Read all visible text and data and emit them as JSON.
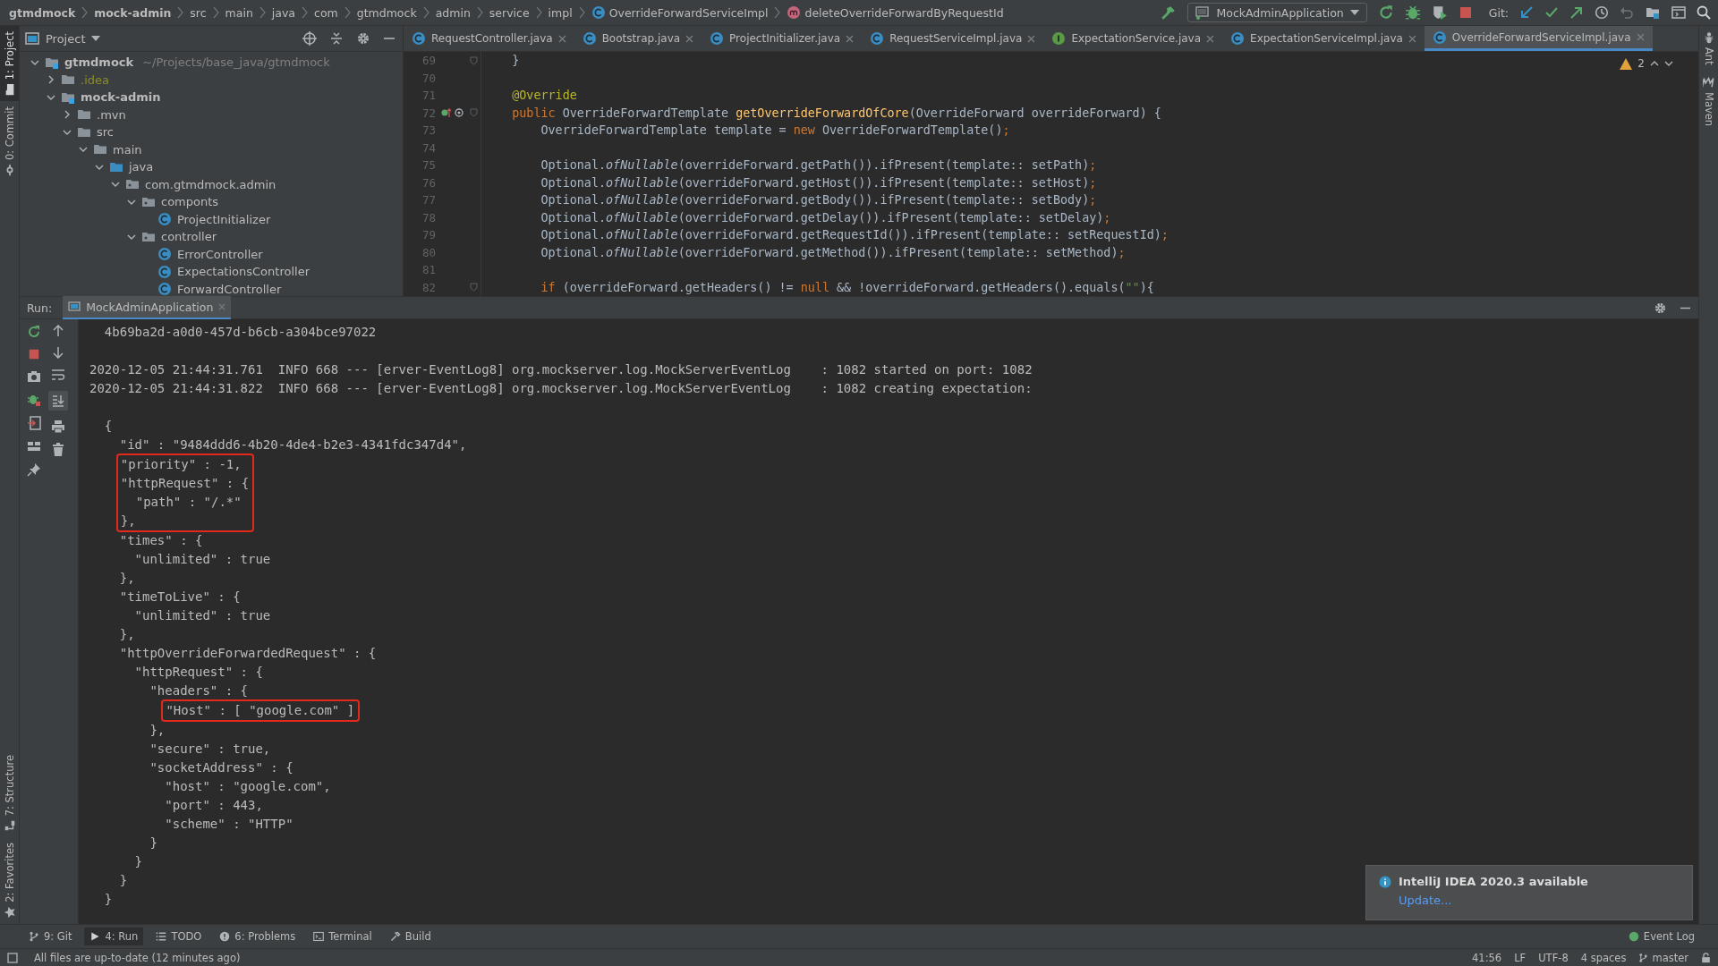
{
  "breadcrumbs": [
    {
      "label": "gtmdmock",
      "kind": "module"
    },
    {
      "label": "mock-admin",
      "kind": "module"
    },
    {
      "label": "src",
      "kind": "folder"
    },
    {
      "label": "main",
      "kind": "folder"
    },
    {
      "label": "java",
      "kind": "folder"
    },
    {
      "label": "com",
      "kind": "folder"
    },
    {
      "label": "gtmdmock",
      "kind": "folder"
    },
    {
      "label": "admin",
      "kind": "folder"
    },
    {
      "label": "service",
      "kind": "folder"
    },
    {
      "label": "impl",
      "kind": "folder"
    },
    {
      "label": "OverrideForwardServiceImpl",
      "kind": "class"
    },
    {
      "label": "deleteOverrideForwardByRequestId",
      "kind": "method"
    }
  ],
  "toolbar": {
    "run_config": "MockAdminApplication",
    "git_label": "Git:"
  },
  "left_stripe": {
    "top": [
      {
        "label": "1: Project",
        "kind": "project",
        "selected": true
      },
      {
        "label": "0: Commit",
        "kind": "commit",
        "selected": false
      }
    ],
    "bottom": [
      {
        "label": "7: Structure",
        "kind": "structure",
        "selected": false
      },
      {
        "label": "2: Favorites",
        "kind": "favorites",
        "selected": false
      }
    ]
  },
  "right_stripe": [
    {
      "label": "Ant",
      "kind": "ant"
    },
    {
      "label": "Maven",
      "kind": "maven"
    }
  ],
  "project": {
    "title": "Project",
    "tree": [
      {
        "name": "gtmdmock",
        "kind": "module",
        "hint": "~/Projects/base_java/gtmdmock",
        "expanded": true,
        "children": [
          {
            "name": ".idea",
            "kind": "folder",
            "ignored": true,
            "expanded": false
          },
          {
            "name": "mock-admin",
            "kind": "module",
            "expanded": true,
            "children": [
              {
                "name": ".mvn",
                "kind": "folder",
                "expanded": false
              },
              {
                "name": "src",
                "kind": "folder",
                "expanded": true,
                "children": [
                  {
                    "name": "main",
                    "kind": "folder",
                    "expanded": true,
                    "children": [
                      {
                        "name": "java",
                        "kind": "source",
                        "expanded": true,
                        "children": [
                          {
                            "name": "com.gtmdmock.admin",
                            "kind": "package",
                            "expanded": true,
                            "children": [
                              {
                                "name": "componts",
                                "kind": "package",
                                "expanded": true,
                                "children": [
                                  {
                                    "name": "ProjectInitializer",
                                    "kind": "class"
                                  }
                                ]
                              },
                              {
                                "name": "controller",
                                "kind": "package",
                                "expanded": true,
                                "children": [
                                  {
                                    "name": "ErrorController",
                                    "kind": "class"
                                  },
                                  {
                                    "name": "ExpectationsController",
                                    "kind": "class"
                                  },
                                  {
                                    "name": "ForwardController",
                                    "kind": "class"
                                  }
                                ]
                              }
                            ]
                          }
                        ]
                      }
                    ]
                  }
                ]
              }
            ]
          }
        ]
      }
    ]
  },
  "editor": {
    "tabs": [
      {
        "label": "RequestController.java",
        "kind": "class",
        "selected": false
      },
      {
        "label": "Bootstrap.java",
        "kind": "class",
        "selected": false
      },
      {
        "label": "ProjectInitializer.java",
        "kind": "class",
        "selected": false
      },
      {
        "label": "RequestServiceImpl.java",
        "kind": "class",
        "selected": false
      },
      {
        "label": "ExpectationService.java",
        "kind": "interface",
        "selected": false
      },
      {
        "label": "ExpectationServiceImpl.java",
        "kind": "class",
        "selected": false
      },
      {
        "label": "OverrideForwardServiceImpl.java",
        "kind": "class",
        "selected": true
      }
    ],
    "warnings": "2",
    "lines": [
      {
        "number": "69",
        "fold": true,
        "override_mark": false,
        "tokens": [
          {
            "text": "    }",
            "kind": "plain"
          }
        ]
      },
      {
        "number": "70",
        "fold": false,
        "override_mark": false
      },
      {
        "number": "71",
        "fold": false,
        "override_mark": false,
        "tokens": [
          {
            "text": "    @Override",
            "kind": "annotation"
          }
        ]
      },
      {
        "number": "72",
        "fold": true,
        "override_mark": true,
        "tokens": [
          {
            "text": "    public ",
            "kind": "keyword"
          },
          {
            "text": "OverrideForwardTemplate ",
            "kind": "plain"
          },
          {
            "text": "getOverrideForwardOfCore",
            "kind": "method"
          },
          {
            "text": "(OverrideForward overrideForward) {",
            "kind": "plain"
          }
        ]
      },
      {
        "number": "73",
        "fold": false,
        "override_mark": false,
        "tokens": [
          {
            "text": "        OverrideForwardTemplate template = ",
            "kind": "plain"
          },
          {
            "text": "new",
            "kind": "keyword"
          },
          {
            "text": " OverrideForwardTemplate()",
            "kind": "plain"
          },
          {
            "text": ";",
            "kind": "punct"
          }
        ]
      },
      {
        "number": "74",
        "fold": false,
        "override_mark": false
      },
      {
        "number": "75",
        "fold": false,
        "override_mark": false,
        "tokens": [
          {
            "text": "        Optional.",
            "kind": "plain"
          },
          {
            "text": "ofNullable",
            "kind": "static"
          },
          {
            "text": "(overrideForward.getPath()).ifPresent(template:: setPath)",
            "kind": "plain"
          },
          {
            "text": ";",
            "kind": "punct"
          }
        ]
      },
      {
        "number": "76",
        "fold": false,
        "override_mark": false,
        "tokens": [
          {
            "text": "        Optional.",
            "kind": "plain"
          },
          {
            "text": "ofNullable",
            "kind": "static"
          },
          {
            "text": "(overrideForward.getHost()).ifPresent(template:: setHost)",
            "kind": "plain"
          },
          {
            "text": ";",
            "kind": "punct"
          }
        ]
      },
      {
        "number": "77",
        "fold": false,
        "override_mark": false,
        "tokens": [
          {
            "text": "        Optional.",
            "kind": "plain"
          },
          {
            "text": "ofNullable",
            "kind": "static"
          },
          {
            "text": "(overrideForward.getBody()).ifPresent(template:: setBody)",
            "kind": "plain"
          },
          {
            "text": ";",
            "kind": "punct"
          }
        ]
      },
      {
        "number": "78",
        "fold": false,
        "override_mark": false,
        "tokens": [
          {
            "text": "        Optional.",
            "kind": "plain"
          },
          {
            "text": "ofNullable",
            "kind": "static"
          },
          {
            "text": "(overrideForward.getDelay()).ifPresent(template:: setDelay)",
            "kind": "plain"
          },
          {
            "text": ";",
            "kind": "punct"
          }
        ]
      },
      {
        "number": "79",
        "fold": false,
        "override_mark": false,
        "tokens": [
          {
            "text": "        Optional.",
            "kind": "plain"
          },
          {
            "text": "ofNullable",
            "kind": "static"
          },
          {
            "text": "(overrideForward.getRequestId()).ifPresent(template:: setRequestId)",
            "kind": "plain"
          },
          {
            "text": ";",
            "kind": "punct"
          }
        ]
      },
      {
        "number": "80",
        "fold": false,
        "override_mark": false,
        "tokens": [
          {
            "text": "        Optional.",
            "kind": "plain"
          },
          {
            "text": "ofNullable",
            "kind": "static"
          },
          {
            "text": "(overrideForward.getMethod()).ifPresent(template:: setMethod)",
            "kind": "plain"
          },
          {
            "text": ";",
            "kind": "punct"
          }
        ]
      },
      {
        "number": "81",
        "fold": false,
        "override_mark": false
      },
      {
        "number": "82",
        "fold": true,
        "override_mark": false,
        "tokens": [
          {
            "text": "        if",
            "kind": "keyword"
          },
          {
            "text": " (overrideForward.getHeaders() != ",
            "kind": "plain"
          },
          {
            "text": "null",
            "kind": "keyword"
          },
          {
            "text": " && !overrideForward.getHeaders().equals(",
            "kind": "plain"
          },
          {
            "text": "\"\"",
            "kind": "string"
          },
          {
            "text": "){",
            "kind": "plain"
          }
        ]
      }
    ]
  },
  "run": {
    "label": "Run:",
    "tab": "MockAdminApplication",
    "console": [
      {
        "kind": "line",
        "text": "  4b69ba2d-a0d0-457d-b6cb-a304bce97022"
      },
      {
        "kind": "gap"
      },
      {
        "kind": "line",
        "text": "2020-12-05 21:44:31.761  INFO 668 --- [erver-EventLog8] org.mockserver.log.MockServerEventLog    : 1082 started on port: 1082"
      },
      {
        "kind": "line",
        "text": "2020-12-05 21:44:31.822  INFO 668 --- [erver-EventLog8] org.mockserver.log.MockServerEventLog    : 1082 creating expectation:"
      },
      {
        "kind": "gap"
      },
      {
        "kind": "line",
        "text": "  {"
      },
      {
        "kind": "line",
        "text": "    \"id\" : \"9484ddd6-4b20-4de4-b2e3-4341fdc347d4\","
      },
      {
        "kind": "box",
        "lines": [
          "    \"priority\" : -1,",
          "    \"httpRequest\" : {",
          "      \"path\" : \"/.*\"",
          "    },"
        ]
      },
      {
        "kind": "line",
        "text": "    \"times\" : {"
      },
      {
        "kind": "line",
        "text": "      \"unlimited\" : true"
      },
      {
        "kind": "line",
        "text": "    },"
      },
      {
        "kind": "line",
        "text": "    \"timeToLive\" : {"
      },
      {
        "kind": "line",
        "text": "      \"unlimited\" : true"
      },
      {
        "kind": "line",
        "text": "    },"
      },
      {
        "kind": "line",
        "text": "    \"httpOverrideForwardedRequest\" : {"
      },
      {
        "kind": "line",
        "text": "      \"httpRequest\" : {"
      },
      {
        "kind": "line",
        "text": "        \"headers\" : {"
      },
      {
        "kind": "box",
        "lines": [
          "          \"Host\" : [ \"google.com\" ]"
        ]
      },
      {
        "kind": "line",
        "text": "        },"
      },
      {
        "kind": "line",
        "text": "        \"secure\" : true,"
      },
      {
        "kind": "line",
        "text": "        \"socketAddress\" : {"
      },
      {
        "kind": "line",
        "text": "          \"host\" : \"google.com\","
      },
      {
        "kind": "line",
        "text": "          \"port\" : 443,"
      },
      {
        "kind": "line",
        "text": "          \"scheme\" : \"HTTP\""
      },
      {
        "kind": "line",
        "text": "        }"
      },
      {
        "kind": "line",
        "text": "      }"
      },
      {
        "kind": "line",
        "text": "    }"
      },
      {
        "kind": "line",
        "text": "  }"
      }
    ]
  },
  "tool_windows": [
    {
      "label": "9: Git",
      "kind": "git",
      "selected": false
    },
    {
      "label": "4: Run",
      "kind": "run",
      "selected": true
    },
    {
      "label": "TODO",
      "kind": "todo",
      "selected": false
    },
    {
      "label": "6: Problems",
      "kind": "problems",
      "selected": false
    },
    {
      "label": "Terminal",
      "kind": "terminal",
      "selected": false
    },
    {
      "label": "Build",
      "kind": "build",
      "selected": false
    }
  ],
  "event_log": "Event Log",
  "notification": {
    "title": "IntelliJ IDEA 2020.3 available",
    "link": "Update..."
  },
  "status_bar": {
    "message": "All files are up-to-date (12 minutes ago)",
    "position": "41:56",
    "line_separator": "LF",
    "encoding": "UTF-8",
    "indent": "4 spaces",
    "branch": "master"
  }
}
